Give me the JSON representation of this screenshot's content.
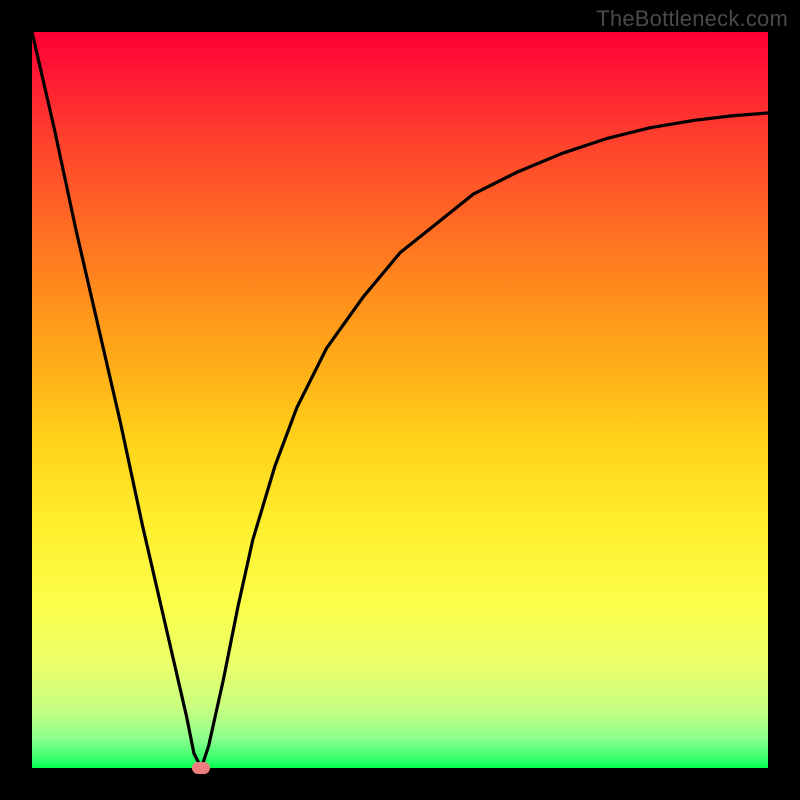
{
  "watermark": "TheBottleneck.com",
  "colors": {
    "frame": "#000000",
    "curve": "#000000",
    "marker": "#ef7d7d",
    "gradient_top": "#ff0034",
    "gradient_bottom": "#00ff4d"
  },
  "chart_data": {
    "type": "line",
    "title": "",
    "xlabel": "",
    "ylabel": "",
    "xlim": [
      0,
      100
    ],
    "ylim": [
      0,
      100
    ],
    "grid": false,
    "legend": false,
    "annotations": [],
    "series": [
      {
        "name": "bottleneck-curve",
        "x": [
          0,
          3,
          6,
          9,
          12,
          15,
          18,
          21,
          22,
          23,
          24,
          26,
          28,
          30,
          33,
          36,
          40,
          45,
          50,
          55,
          60,
          66,
          72,
          78,
          84,
          90,
          95,
          100
        ],
        "values": [
          100,
          87,
          73,
          60,
          47,
          33,
          20,
          7,
          2,
          0,
          3,
          12,
          22,
          31,
          41,
          49,
          57,
          64,
          70,
          74,
          78,
          81,
          83.5,
          85.5,
          87,
          88,
          88.6,
          89
        ]
      }
    ],
    "marker": {
      "x": 23,
      "y": 0
    }
  }
}
